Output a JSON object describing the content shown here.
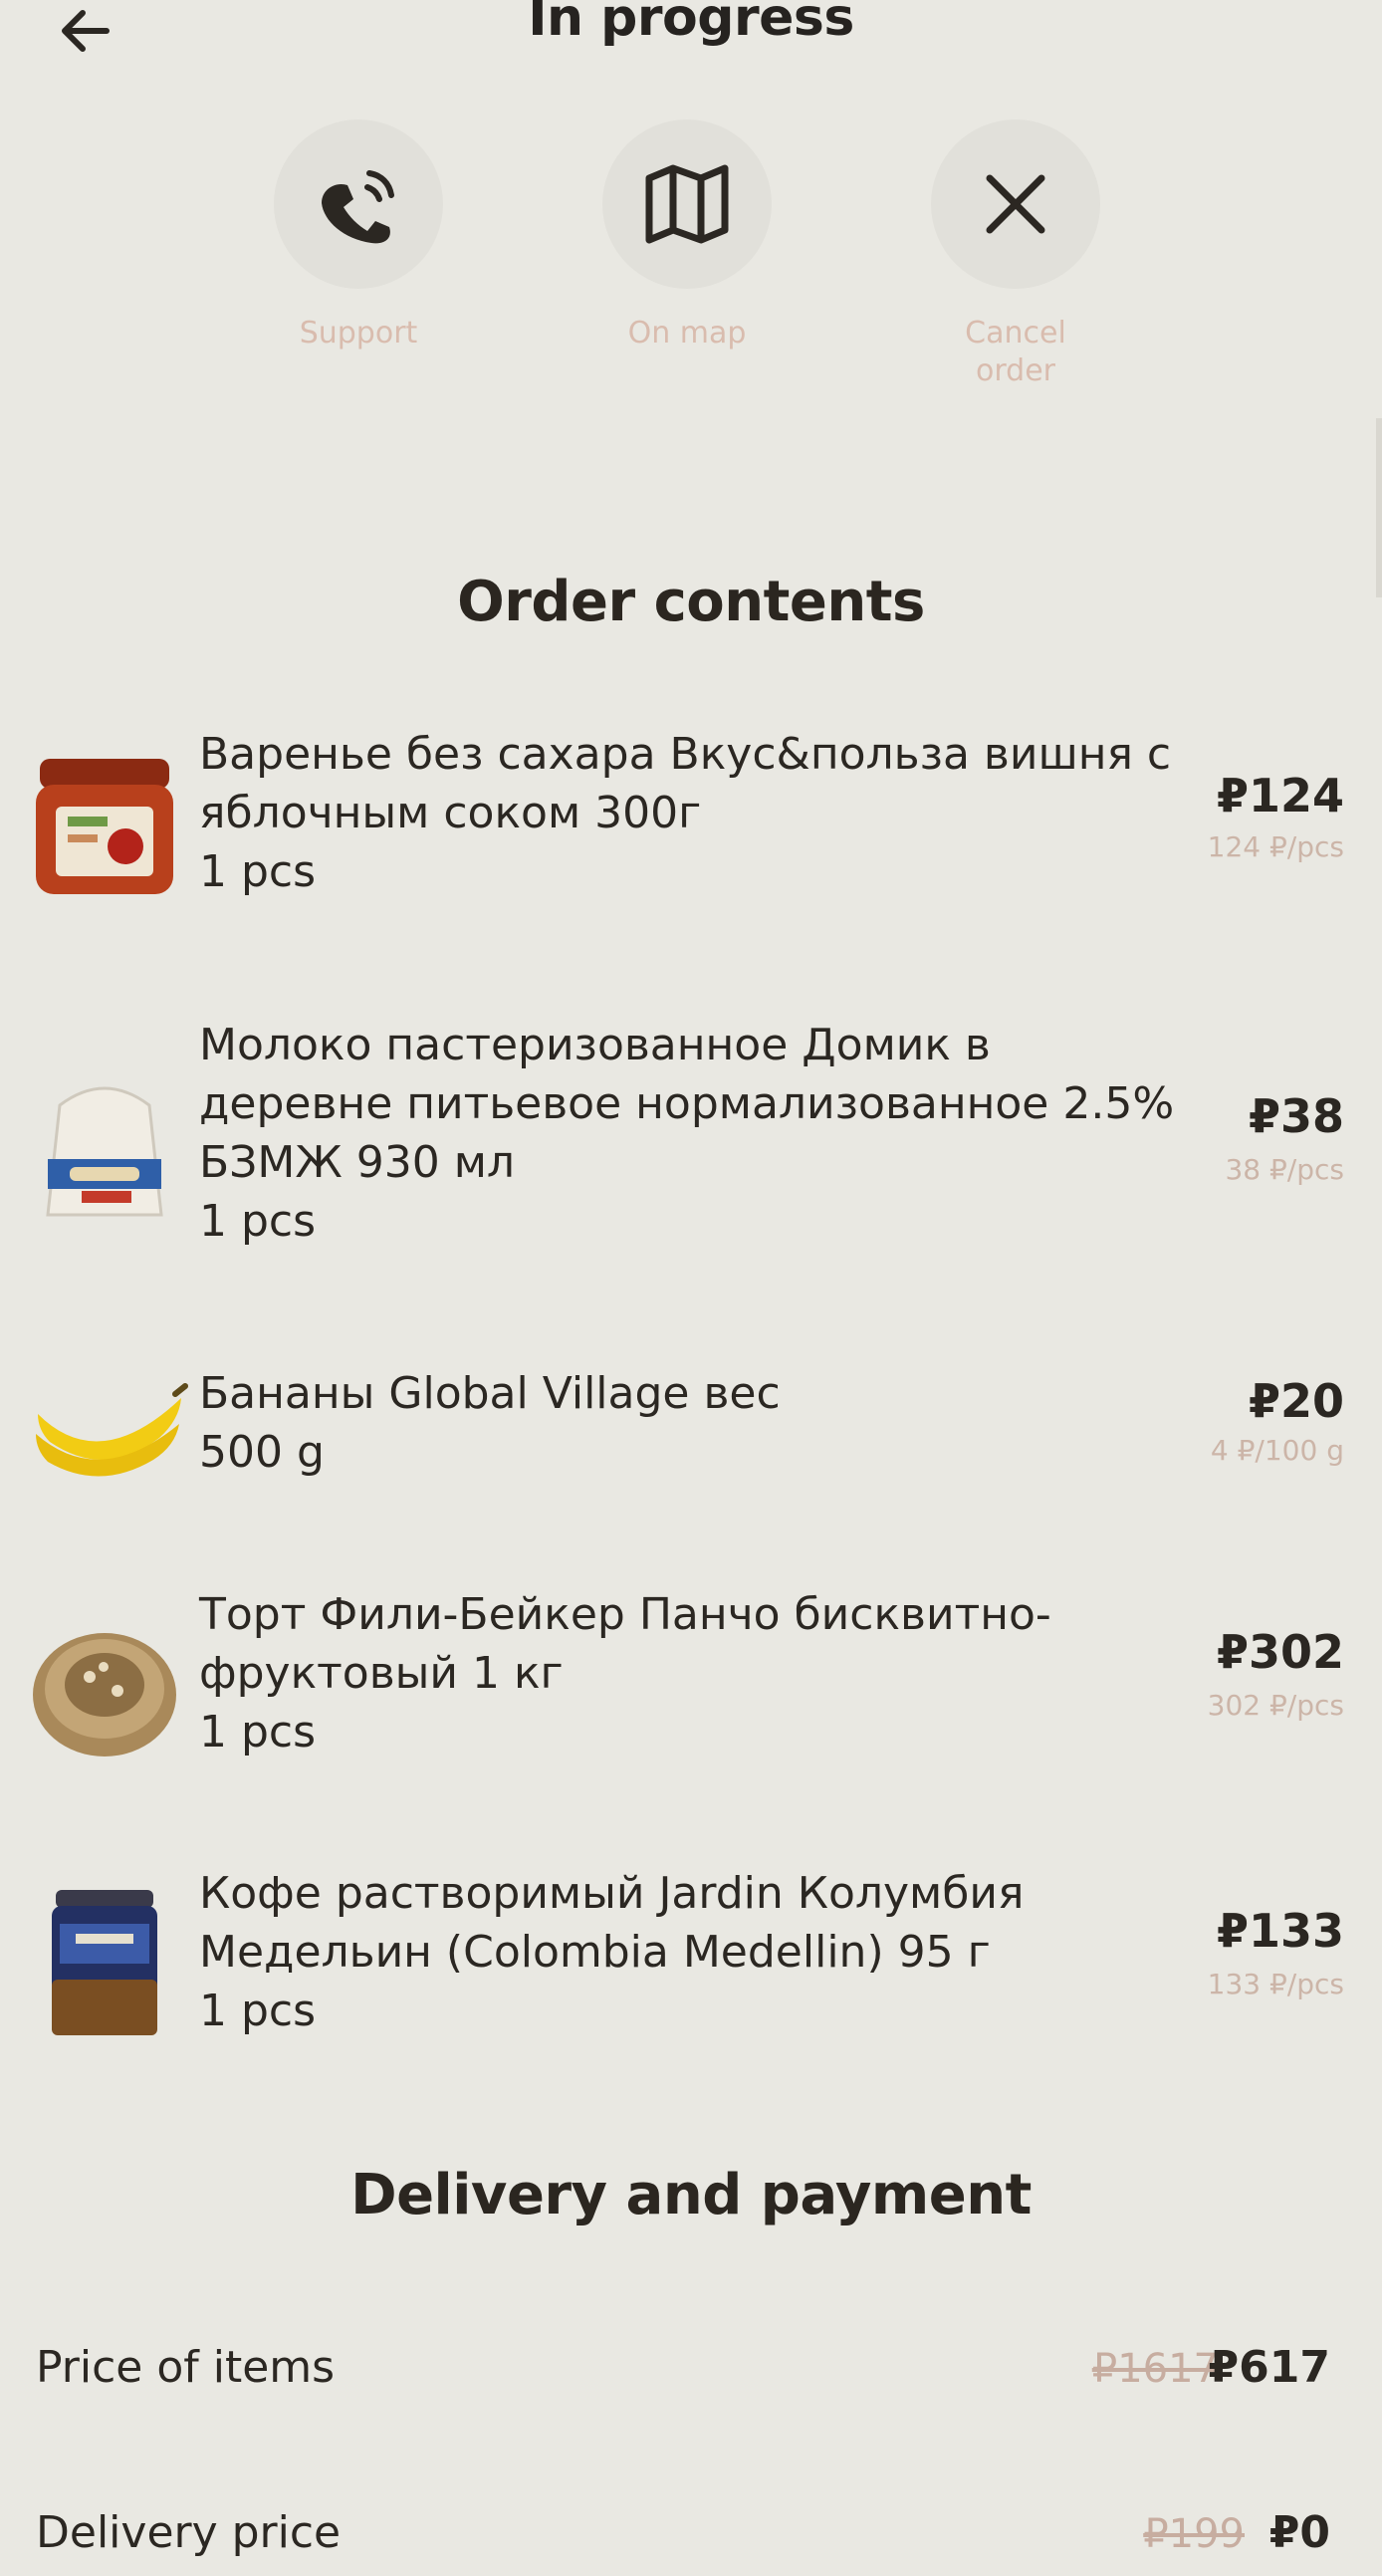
{
  "header": {
    "title": "In progress"
  },
  "actions": [
    {
      "label": "Support",
      "icon": "phone-icon"
    },
    {
      "label": "On map",
      "icon": "map-icon"
    },
    {
      "label": "Cancel order",
      "icon": "close-icon"
    }
  ],
  "order": {
    "title": "Order contents",
    "items": [
      {
        "name": "Варенье без сахара Вкус&польза вишня с яблочным соком 300г",
        "qty": "1 pcs",
        "price": "₽124",
        "unit_price": "124 ₽/pcs"
      },
      {
        "name": "Молоко пастеризованное Домик в деревне питьевое нормализованное 2.5% БЗМЖ 930 мл",
        "qty": "1 pcs",
        "price": "₽38",
        "unit_price": "38 ₽/pcs"
      },
      {
        "name": "Бананы Global Village вес",
        "qty": "500 g",
        "price": "₽20",
        "unit_price": "4 ₽/100 g"
      },
      {
        "name": "Торт Фили-Бейкер Панчо бисквитно-фруктовый 1 кг",
        "qty": "1 pcs",
        "price": "₽302",
        "unit_price": "302 ₽/pcs"
      },
      {
        "name": "Кофе растворимый Jardin Колумбия Медельин (Colombia Medellin) 95 г",
        "qty": "1 pcs",
        "price": "₽133",
        "unit_price": "133 ₽/pcs"
      }
    ]
  },
  "delivery": {
    "title": "Delivery and payment",
    "price_of_items": {
      "label": "Price of items",
      "old": "₽1617",
      "value": "₽617"
    },
    "delivery_price": {
      "label": "Delivery price",
      "old": "₽199",
      "value": "₽0"
    }
  },
  "colors": {
    "background": "#e9e8e2",
    "text": "#2b2722",
    "muted_label": "#d9bcae"
  }
}
